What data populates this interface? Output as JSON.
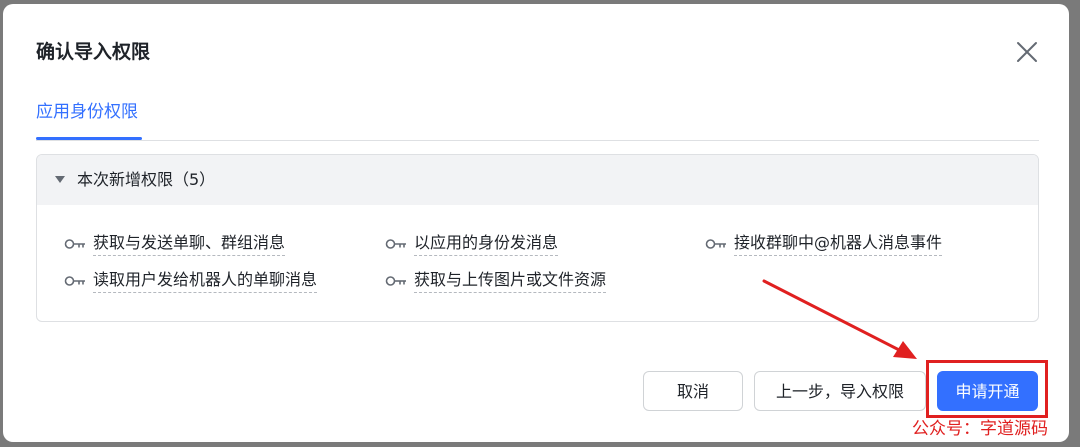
{
  "dialog": {
    "title": "确认导入权限",
    "close_icon": "close-icon"
  },
  "tabs": [
    {
      "label": "应用身份权限",
      "active": true
    }
  ],
  "panel": {
    "title": "本次新增权限（5）",
    "permissions": [
      "获取与发送单聊、群组消息",
      "以应用的身份发消息",
      "接收群聊中@机器人消息事件",
      "读取用户发给机器人的单聊消息",
      "获取与上传图片或文件资源"
    ],
    "permission_icon": "key-icon"
  },
  "footer": {
    "cancel_label": "取消",
    "prev_label": "上一步，导入权限",
    "apply_label": "申请开通"
  },
  "annotation": {
    "watermark": "公众号：字道源码",
    "color": "#e02020"
  },
  "colors": {
    "accent": "#3370ff",
    "text": "#1f2329",
    "panel_header_bg": "#f2f3f5",
    "border": "#dee0e3"
  }
}
